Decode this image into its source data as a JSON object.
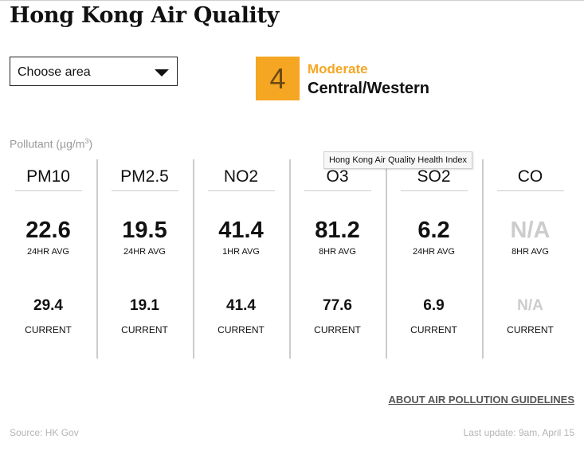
{
  "title": "Hong Kong Air Quality",
  "area_select": {
    "value": "Choose area",
    "icon": "chevron-down-icon"
  },
  "aqhi": {
    "value": "4",
    "level": "Moderate",
    "district": "Central/Western",
    "color": "#f5a623",
    "tooltip": "Hong Kong Air Quality Health Index"
  },
  "pollutant_label": {
    "text": "Pollutant (µg/m",
    "superscript": "3",
    "suffix": ")"
  },
  "pollutants": [
    {
      "name": "PM10",
      "avg_value": "22.6",
      "avg_label": "24HR AVG",
      "current_value": "29.4",
      "current_label": "CURRENT"
    },
    {
      "name": "PM2.5",
      "avg_value": "19.5",
      "avg_label": "24HR AVG",
      "current_value": "19.1",
      "current_label": "CURRENT"
    },
    {
      "name": "NO2",
      "avg_value": "41.4",
      "avg_label": "1HR AVG",
      "current_value": "41.4",
      "current_label": "CURRENT"
    },
    {
      "name": "O3",
      "avg_value": "81.2",
      "avg_label": "8HR AVG",
      "current_value": "77.6",
      "current_label": "CURRENT"
    },
    {
      "name": "SO2",
      "avg_value": "6.2",
      "avg_label": "24HR AVG",
      "current_value": "6.9",
      "current_label": "CURRENT"
    },
    {
      "name": "CO",
      "avg_value": "N/A",
      "avg_label": "8HR AVG",
      "current_value": "N/A",
      "current_label": "CURRENT"
    }
  ],
  "guidelines_link": "ABOUT AIR POLLUTION GUIDELINES",
  "source": "Source: HK Gov",
  "last_update": "Last update:  9am, April 15"
}
